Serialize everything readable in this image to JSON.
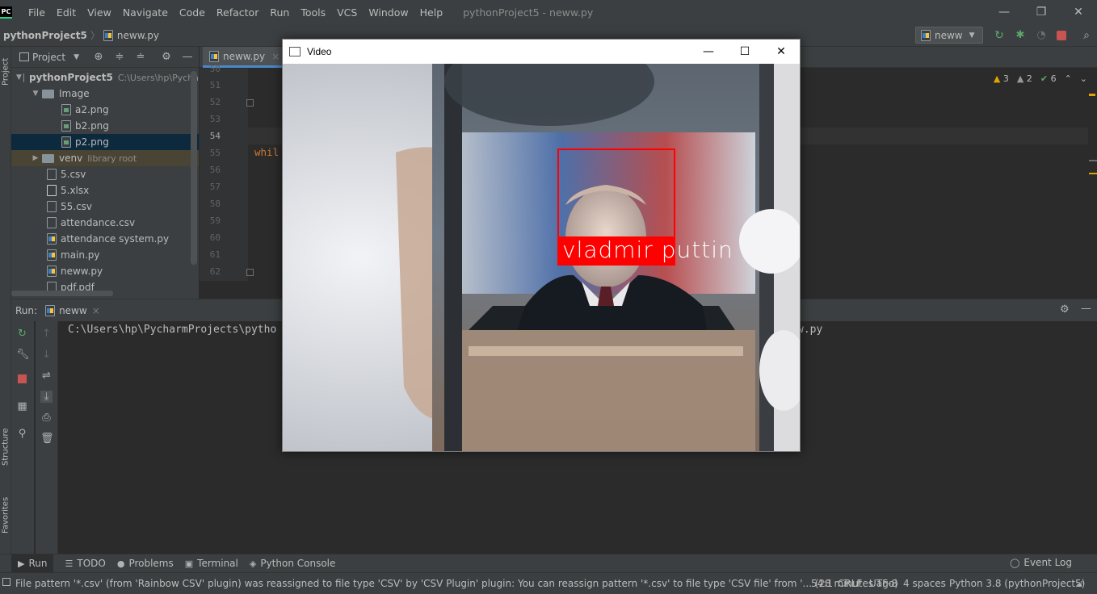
{
  "menubar": {
    "logo": "PC",
    "items": [
      "File",
      "Edit",
      "View",
      "Navigate",
      "Code",
      "Refactor",
      "Run",
      "Tools",
      "VCS",
      "Window",
      "Help"
    ],
    "window_title": "pythonProject5 - neww.py",
    "controls": {
      "minimize": "—",
      "restore": "❐",
      "close": "✕"
    }
  },
  "navbar": {
    "project": "pythonProject5",
    "separator": "〉",
    "file": "neww.py",
    "run_config": "neww"
  },
  "left_stripe": {
    "project_tab": "Project",
    "structure_tab": "Structure",
    "favorites_tab": "Favorites"
  },
  "project_panel": {
    "title": "Project",
    "tree": [
      {
        "label": "pythonProject5",
        "detail": "C:\\Users\\hp\\Pycha",
        "kind": "root-folder"
      },
      {
        "label": "Image",
        "kind": "folder"
      },
      {
        "label": "a2.png",
        "kind": "png"
      },
      {
        "label": "b2.png",
        "kind": "png"
      },
      {
        "label": "p2.png",
        "kind": "png",
        "selected": true
      },
      {
        "label": "venv",
        "detail": "library root",
        "kind": "folder"
      },
      {
        "label": "5.csv",
        "kind": "csv"
      },
      {
        "label": "5.xlsx",
        "kind": "xlsx"
      },
      {
        "label": "55.csv",
        "kind": "csv"
      },
      {
        "label": "attendance.csv",
        "kind": "csv"
      },
      {
        "label": "attendance system.py",
        "kind": "py"
      },
      {
        "label": "main.py",
        "kind": "py"
      },
      {
        "label": "neww.py",
        "kind": "py"
      },
      {
        "label": "pdf.pdf",
        "kind": "pdf"
      }
    ]
  },
  "editor": {
    "tab_label": "neww.py",
    "tab_close": "×",
    "line_numbers": [
      "50",
      "51",
      "52",
      "53",
      "54",
      "55",
      "56",
      "57",
      "58",
      "59",
      "60",
      "61",
      "62"
    ],
    "current_line": "54",
    "code_visible": "whil",
    "inspections": {
      "warnings": "3",
      "weak_warnings": "2",
      "ok": "6"
    }
  },
  "run_panel": {
    "label": "Run:",
    "tab_label": "neww",
    "tab_close": "×",
    "console_start": "C:\\Users\\hp\\PycharmProjects\\pytho",
    "console_end": "w.py"
  },
  "tool_windows": {
    "run": "Run",
    "todo": "TODO",
    "problems": "Problems",
    "terminal": "Terminal",
    "python_console": "Python Console",
    "event_log": "Event Log"
  },
  "status_bar": {
    "message": "File pattern '*.csv' (from 'Rainbow CSV' plugin) was reassigned to file type 'CSV' by 'CSV Plugin' plugin: You can reassign pattern '*.csv' to file type 'CSV file' from '... (28 minutes ago)",
    "position": "54:1",
    "line_separator": "CRLF",
    "encoding": "UTF-8",
    "indent": "4 spaces",
    "interpreter": "Python 3.8 (pythonProject5)"
  },
  "video_window": {
    "title": "Video",
    "controls": {
      "minimize": "—",
      "maximize": "☐",
      "close": "✕"
    },
    "recognized_name": "vladmir puttin",
    "box_color": "#ff0000"
  },
  "colors": {
    "panel": "#3c3f41",
    "editor_bg": "#2b2b2b",
    "accent_blue": "#4a88c7",
    "warning": "#e0a300"
  }
}
